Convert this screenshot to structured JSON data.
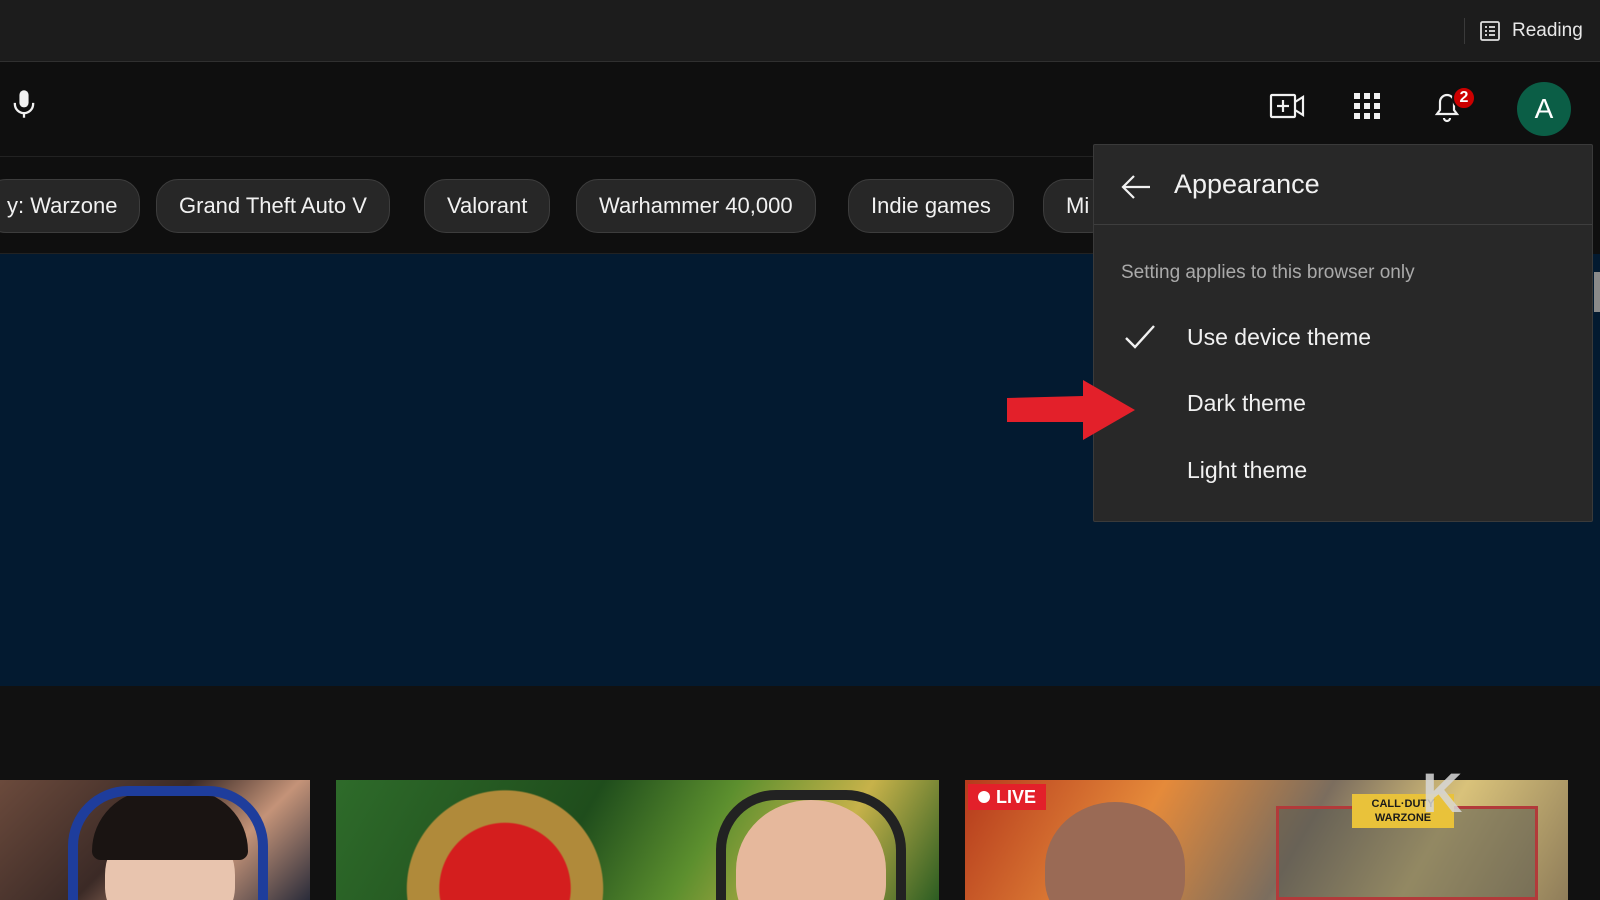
{
  "browser": {
    "reading_label": "Reading"
  },
  "masthead": {
    "notification_count": "2",
    "avatar_letter": "A"
  },
  "chips": [
    {
      "label": "y: Warzone"
    },
    {
      "label": "Grand Theft Auto V"
    },
    {
      "label": "Valorant"
    },
    {
      "label": "Warhammer 40,000"
    },
    {
      "label": "Indie games"
    },
    {
      "label": "Mi"
    }
  ],
  "appearance_menu": {
    "title": "Appearance",
    "note": "Setting applies to this browser only",
    "options": [
      {
        "label": "Use device theme",
        "selected": true
      },
      {
        "label": "Dark theme",
        "selected": false
      },
      {
        "label": "Light theme",
        "selected": false
      }
    ]
  },
  "thumbnails": {
    "live_label": "LIVE",
    "cod_tag": "CALL·DUTY WARZONE",
    "watermark": "K"
  },
  "colors": {
    "accent_red": "#e3202a",
    "avatar_bg": "#0b5e46",
    "banner_bg": "#031a30",
    "menu_bg": "#282828"
  },
  "icons": [
    "reading-list-icon",
    "mic-icon",
    "create-video-icon",
    "apps-grid-icon",
    "bell-icon",
    "back-arrow-icon",
    "checkmark-icon",
    "red-arrow-annotation"
  ]
}
